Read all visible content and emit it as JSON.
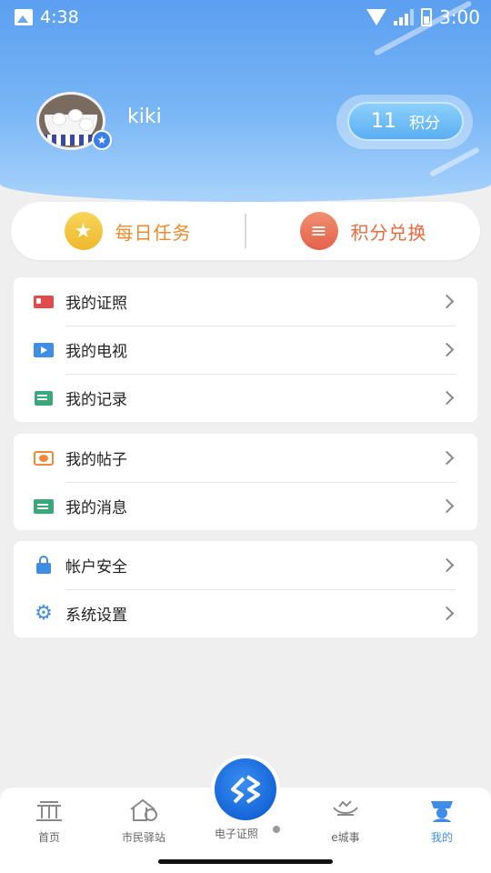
{
  "status_bar": {
    "time_left": "4:38",
    "time_right": "3:00"
  },
  "profile": {
    "username": "kiki",
    "points_value": "11",
    "points_unit": "积分"
  },
  "tasks": [
    {
      "label": "每日任务",
      "icon": "star-icon"
    },
    {
      "label": "积分兑换",
      "icon": "coins-icon"
    }
  ],
  "menu_groups": [
    [
      {
        "label": "我的证照",
        "icon": "id-card-icon"
      },
      {
        "label": "我的电视",
        "icon": "tv-icon"
      },
      {
        "label": "我的记录",
        "icon": "record-icon"
      }
    ],
    [
      {
        "label": "我的帖子",
        "icon": "post-icon"
      },
      {
        "label": "我的消息",
        "icon": "message-icon"
      }
    ],
    [
      {
        "label": "帐户安全",
        "icon": "lock-icon"
      },
      {
        "label": "系统设置",
        "icon": "gear-icon"
      }
    ]
  ],
  "tabbar": {
    "tabs": [
      {
        "label": "首页",
        "icon": "home-gate-icon"
      },
      {
        "label": "市民驿站",
        "icon": "station-icon"
      },
      {
        "label": "电子证照",
        "icon": "e-license-icon"
      },
      {
        "label": "e城事",
        "icon": "ecity-icon"
      },
      {
        "label": "我的",
        "icon": "profile-icon"
      }
    ],
    "active": "我的"
  },
  "colors": {
    "accent": "#3f8de6",
    "task_orange": "#ee8a2a",
    "header_blue": "#5b9ff0"
  }
}
